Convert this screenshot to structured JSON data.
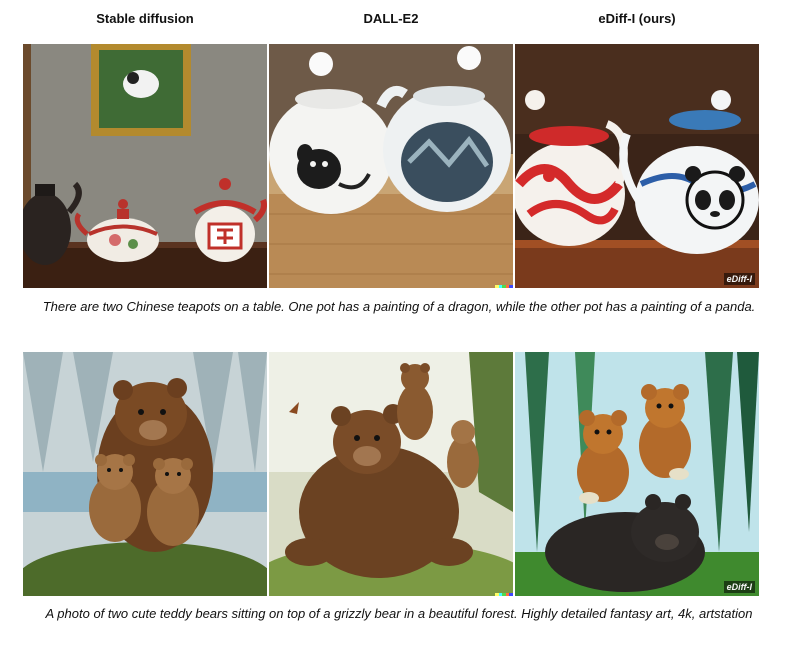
{
  "headers": {
    "col1": "Stable diffusion",
    "col2": "DALL-E2",
    "col3": "eDiff-I (ours)"
  },
  "captions": {
    "row1": "There are two Chinese teapots on a table. One pot has a painting of a dragon, while the other pot has a painting of a panda.",
    "row2": "A photo of two cute teddy bears sitting on top of a grizzly bear in a beautiful forest. Highly detailed fantasy art, 4k, artstation"
  },
  "watermarks": {
    "row1_col3": "eDiff-I",
    "row2_col3": "eDiff-I"
  },
  "colors": {
    "dalle_mark": [
      "#ffff66",
      "#42ffff",
      "#51da4c",
      "#ff6e3c",
      "#3c46ff"
    ]
  }
}
